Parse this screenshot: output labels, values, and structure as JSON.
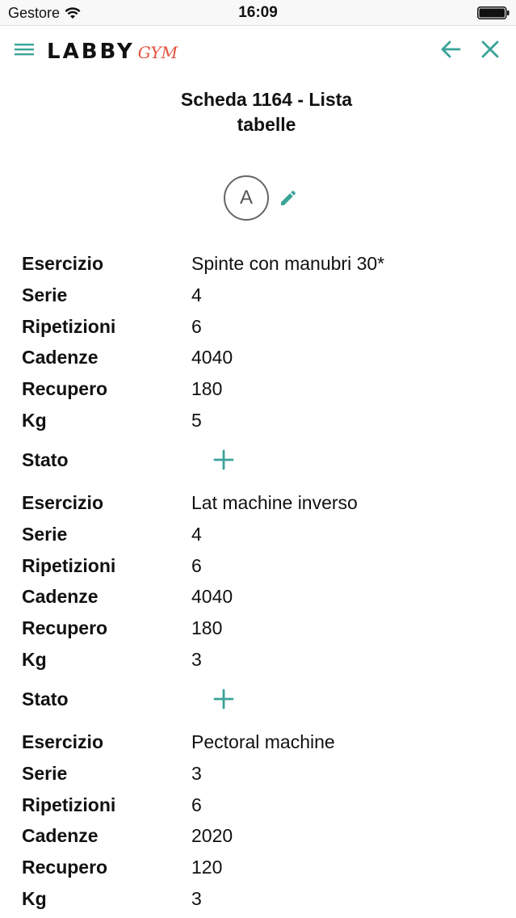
{
  "status_bar": {
    "carrier": "Gestore",
    "time": "16:09"
  },
  "nav": {
    "logo_main": "LABBY",
    "logo_sub": "GYM"
  },
  "page": {
    "title_line1": "Scheda 1164 - Lista",
    "title_line2": "tabelle",
    "avatar_letter": "A"
  },
  "colors": {
    "accent": "#3aa398",
    "logo_accent": "#e2523c"
  },
  "exercises": [
    {
      "rows": [
        {
          "label": "Esercizio",
          "value": "Spinte con manubri 30*"
        },
        {
          "label": "Serie",
          "value": "4"
        },
        {
          "label": "Ripetizioni",
          "value": "6"
        },
        {
          "label": "Cadenze",
          "value": "4040"
        },
        {
          "label": "Recupero",
          "value": "180"
        },
        {
          "label": "Kg",
          "value": "5"
        }
      ],
      "stato_label": "Stato"
    },
    {
      "rows": [
        {
          "label": "Esercizio",
          "value": "Lat machine inverso"
        },
        {
          "label": "Serie",
          "value": "4"
        },
        {
          "label": "Ripetizioni",
          "value": "6"
        },
        {
          "label": "Cadenze",
          "value": "4040"
        },
        {
          "label": "Recupero",
          "value": "180"
        },
        {
          "label": "Kg",
          "value": "3"
        }
      ],
      "stato_label": "Stato"
    },
    {
      "rows": [
        {
          "label": "Esercizio",
          "value": "Pectoral machine"
        },
        {
          "label": "Serie",
          "value": "3"
        },
        {
          "label": "Ripetizioni",
          "value": "6"
        },
        {
          "label": "Cadenze",
          "value": "2020"
        },
        {
          "label": "Recupero",
          "value": "120"
        },
        {
          "label": "Kg",
          "value": "3"
        }
      ]
    }
  ]
}
